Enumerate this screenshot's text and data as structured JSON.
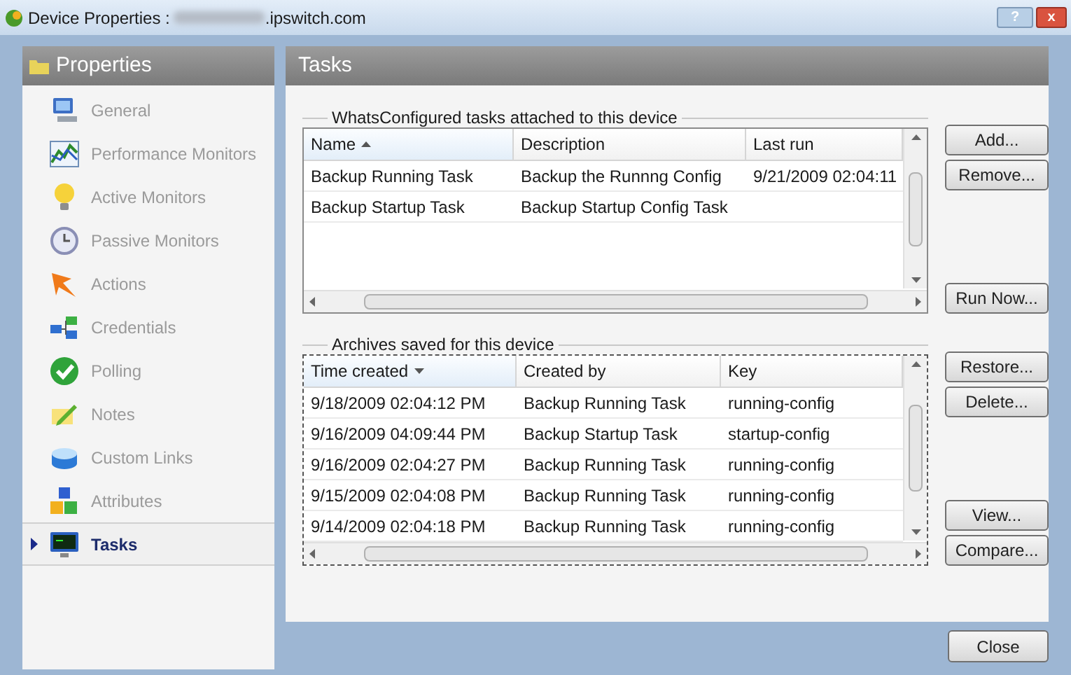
{
  "window": {
    "title": "Device Properties :",
    "title_host": ".ipswitch.com",
    "controls": [
      {
        "kind": "help",
        "label": "?"
      },
      {
        "kind": "close",
        "label": "x"
      }
    ]
  },
  "sidebar": {
    "title": "Properties",
    "items": [
      {
        "label": "General",
        "selected": false
      },
      {
        "label": "Performance Monitors",
        "selected": false
      },
      {
        "label": "Active Monitors",
        "selected": false
      },
      {
        "label": "Passive Monitors",
        "selected": false
      },
      {
        "label": "Actions",
        "selected": false
      },
      {
        "label": "Credentials",
        "selected": false
      },
      {
        "label": "Polling",
        "selected": false
      },
      {
        "label": "Notes",
        "selected": false
      },
      {
        "label": "Custom Links",
        "selected": false
      },
      {
        "label": "Attributes",
        "selected": false
      },
      {
        "label": "Tasks",
        "selected": true
      }
    ]
  },
  "panel": {
    "title": "Tasks",
    "tasks": {
      "legend": "WhatsConfigured tasks attached to this device",
      "columns": [
        {
          "label": "Name",
          "sorted": true,
          "descending": false
        },
        {
          "label": "Description",
          "sorted": false
        },
        {
          "label": "Last run",
          "sorted": false
        }
      ],
      "rows": [
        [
          "Backup Running Task",
          "Backup the Runnng Config",
          "9/21/2009 02:04:11"
        ],
        [
          "Backup Startup Task",
          "Backup Startup Config Task",
          ""
        ]
      ],
      "buttons": [
        "Add...",
        "Remove..."
      ],
      "lower_buttons": [
        "Run Now..."
      ]
    },
    "archives": {
      "legend": "Archives saved for this device",
      "columns": [
        {
          "label": "Time created",
          "sorted": true,
          "descending": true
        },
        {
          "label": "Created by",
          "sorted": false
        },
        {
          "label": "Key",
          "sorted": false
        }
      ],
      "rows": [
        [
          "9/18/2009 02:04:12 PM",
          "Backup Running Task",
          "running-config"
        ],
        [
          "9/16/2009 04:09:44 PM",
          "Backup Startup Task",
          "startup-config"
        ],
        [
          "9/16/2009 02:04:27 PM",
          "Backup Running Task",
          "running-config"
        ],
        [
          "9/15/2009 02:04:08 PM",
          "Backup Running Task",
          "running-config"
        ],
        [
          "9/14/2009 02:04:18 PM",
          "Backup Running Task",
          "running-config"
        ]
      ],
      "buttons": [
        "Restore...",
        "Delete..."
      ],
      "lower_buttons": [
        "View...",
        "Compare..."
      ]
    }
  },
  "footer": {
    "buttons": [
      "Close"
    ]
  }
}
